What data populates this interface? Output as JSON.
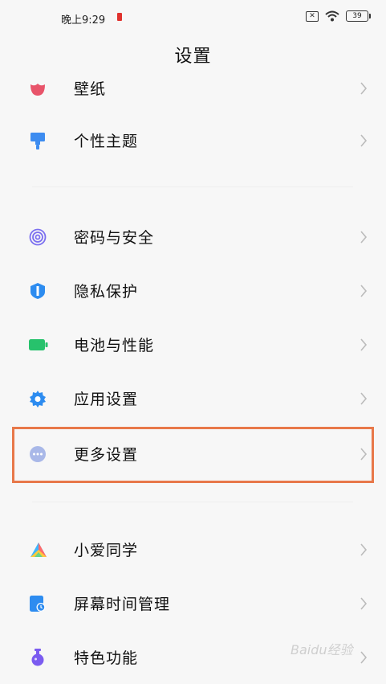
{
  "status_bar": {
    "time": "晚上9:29",
    "battery": "39"
  },
  "header": {
    "title": "设置"
  },
  "settings": [
    {
      "label": "壁纸",
      "icon": "wallpaper-icon",
      "color": "#e8546a"
    },
    {
      "label": "个性主题",
      "icon": "theme-brush-icon",
      "color": "#3d8cf0"
    },
    {
      "label": "密码与安全",
      "icon": "fingerprint-icon",
      "color": "#7b6ff0"
    },
    {
      "label": "隐私保护",
      "icon": "privacy-shield-icon",
      "color": "#2d8cf0"
    },
    {
      "label": "电池与性能",
      "icon": "battery-icon",
      "color": "#27c26c"
    },
    {
      "label": "应用设置",
      "icon": "gear-icon",
      "color": "#2d8cf0"
    },
    {
      "label": "更多设置",
      "icon": "more-dots-icon",
      "color": "#a9b8e8"
    },
    {
      "label": "小爱同学",
      "icon": "xiaoai-icon",
      "color": "#ff6b6b"
    },
    {
      "label": "屏幕时间管理",
      "icon": "screen-time-icon",
      "color": "#2d8cf0"
    },
    {
      "label": "特色功能",
      "icon": "flask-icon",
      "color": "#7b5cf0"
    }
  ],
  "highlighted_item": "更多设置",
  "watermark": "Baidu经验"
}
